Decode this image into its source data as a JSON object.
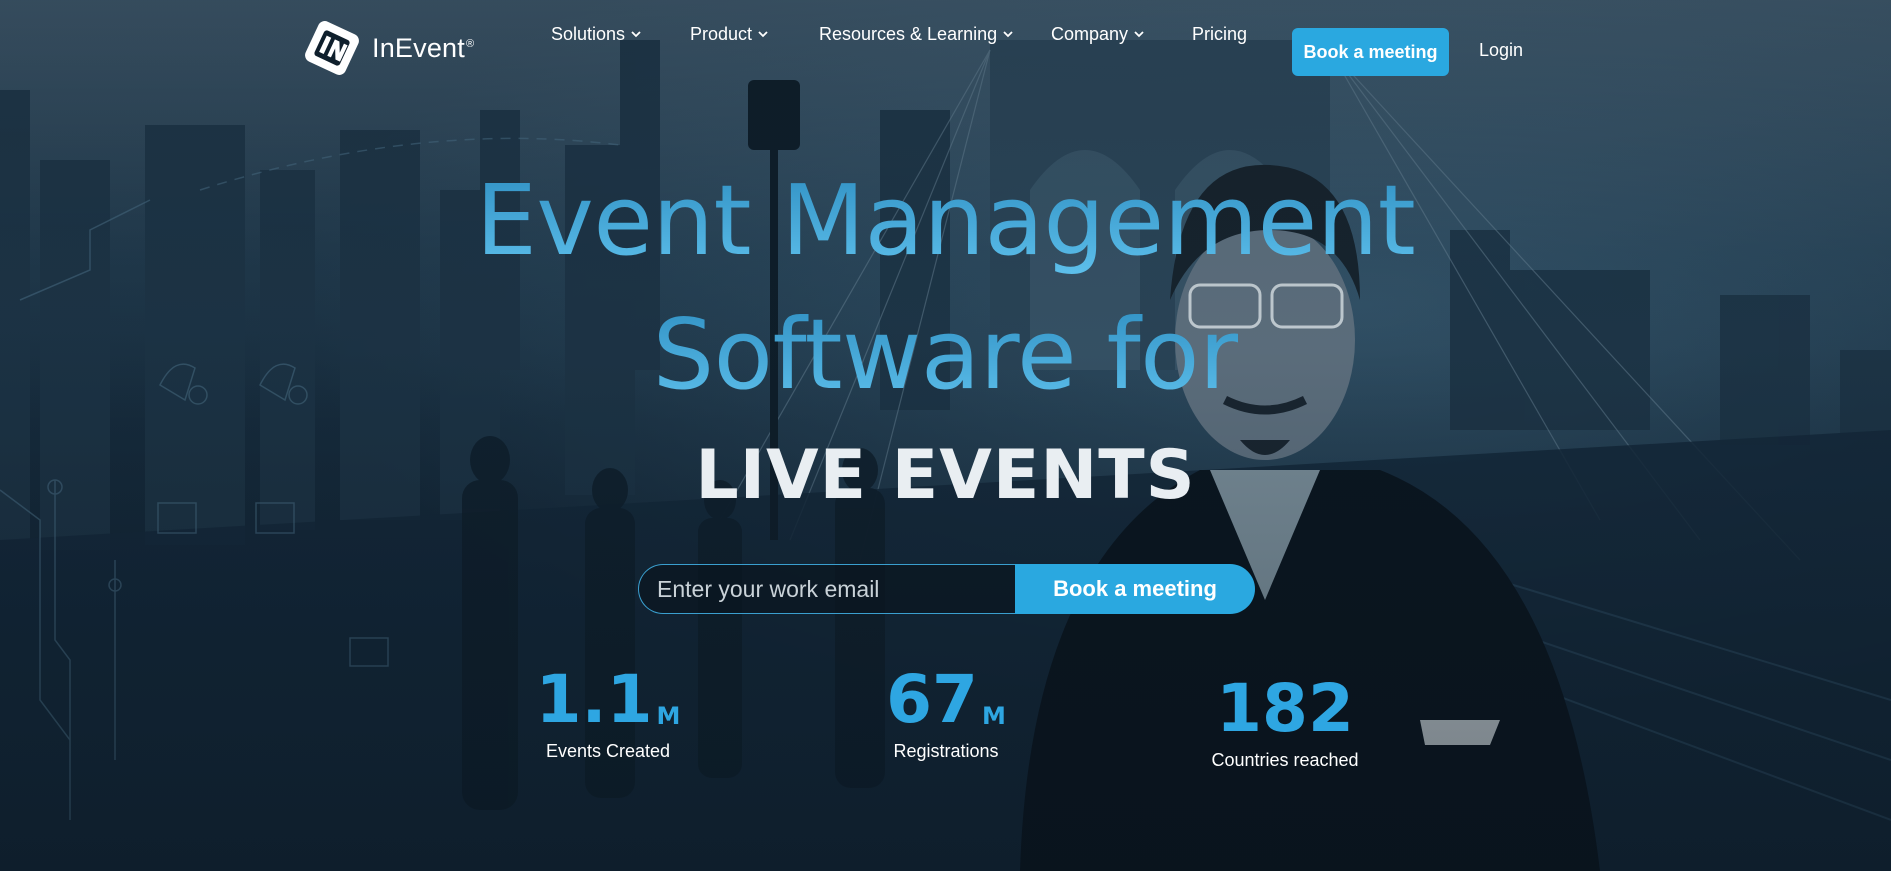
{
  "brand": {
    "name": "InEvent",
    "registered_mark": "®",
    "accent_color": "#2aa8e0",
    "headline_color": "#4eb4e3"
  },
  "nav": {
    "items": [
      {
        "label": "Solutions",
        "has_dropdown": true
      },
      {
        "label": "Product",
        "has_dropdown": true
      },
      {
        "label": "Resources & Learning",
        "has_dropdown": true
      },
      {
        "label": "Company",
        "has_dropdown": true
      },
      {
        "label": "Pricing",
        "has_dropdown": false
      }
    ],
    "cta_label": "Book a meeting",
    "login_label": "Login"
  },
  "hero": {
    "headline_line1": "Event Management",
    "headline_line2": "Software for",
    "headline_line3": "LIVE EVENTS"
  },
  "email_form": {
    "placeholder": "Enter your work email",
    "submit_label": "Book a meeting"
  },
  "stats": [
    {
      "value": "1.1",
      "unit": "M",
      "label": "Events Created"
    },
    {
      "value": "67",
      "unit": "M",
      "label": "Registrations"
    },
    {
      "value": "182",
      "unit": "",
      "label": "Countries reached"
    }
  ],
  "icons": {
    "logo": "inevent-logo-icon",
    "dropdown": "chevron-down-icon"
  }
}
